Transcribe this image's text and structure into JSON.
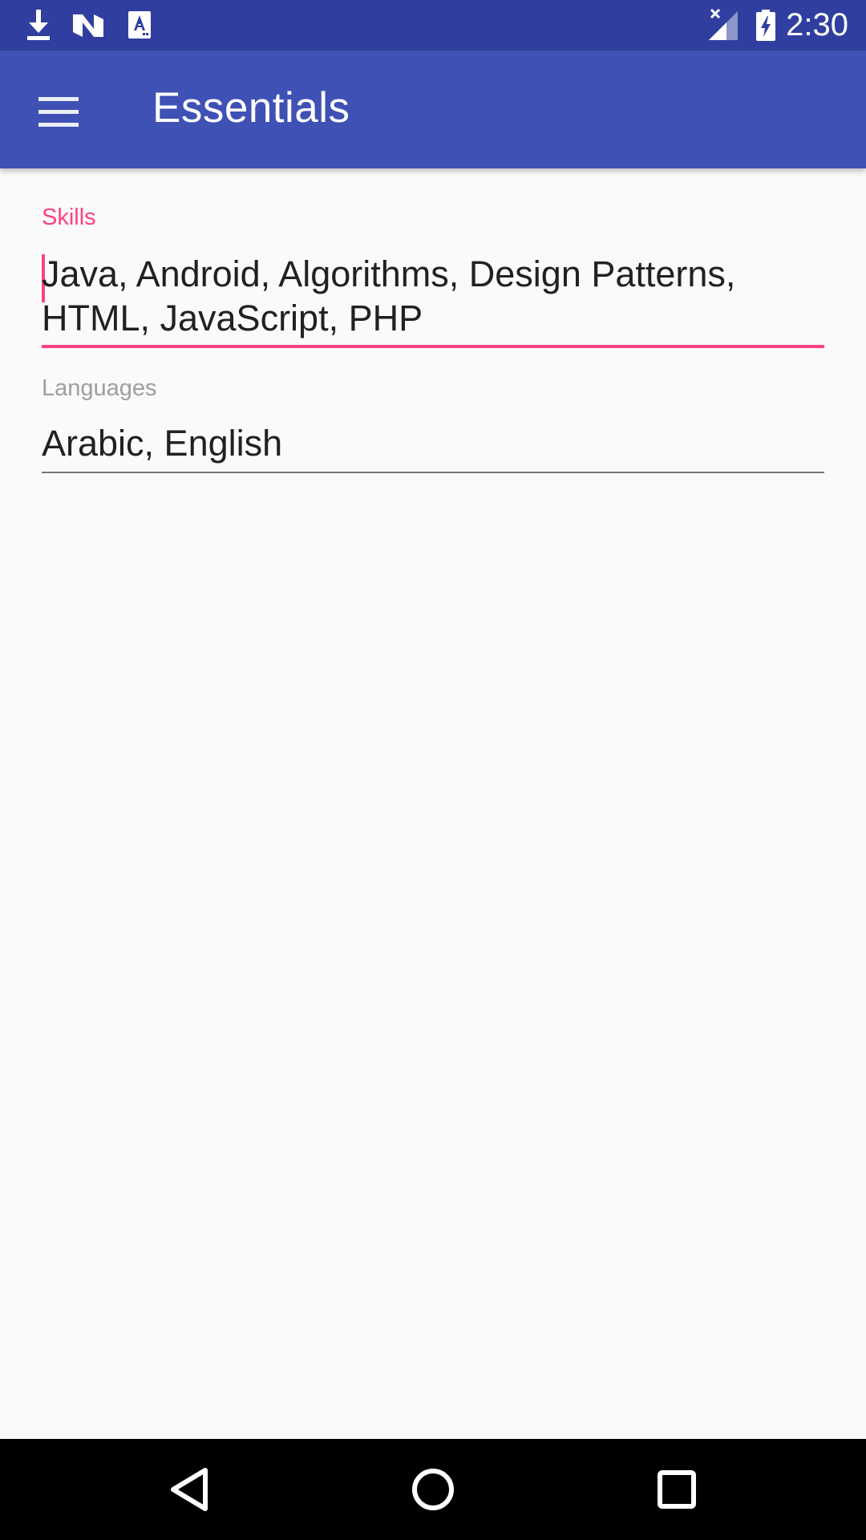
{
  "status_bar": {
    "time": "2:30",
    "icons": [
      "download-icon",
      "n-notification-icon",
      "a-notification-icon",
      "signal-no-data-icon",
      "battery-charging-icon"
    ]
  },
  "app_bar": {
    "title": "Essentials",
    "menu_icon": "hamburger-menu-icon"
  },
  "form": {
    "skills": {
      "label": "Skills",
      "value": "Java, Android, Algorithms, Design Patterns, HTML, JavaScript, PHP",
      "focused": true
    },
    "languages": {
      "label": "Languages",
      "value": "Arabic, English",
      "focused": false
    }
  },
  "nav_bar": {
    "icons": [
      "back-icon",
      "home-icon",
      "recents-icon"
    ]
  },
  "colors": {
    "status_bar": "#303f9f",
    "app_bar": "#3f51b5",
    "accent": "#ff4081",
    "background": "#fafafa",
    "text_primary": "#212121",
    "label_inactive": "#9e9e9e",
    "underline_inactive": "#757575",
    "nav_bar": "#000000"
  }
}
